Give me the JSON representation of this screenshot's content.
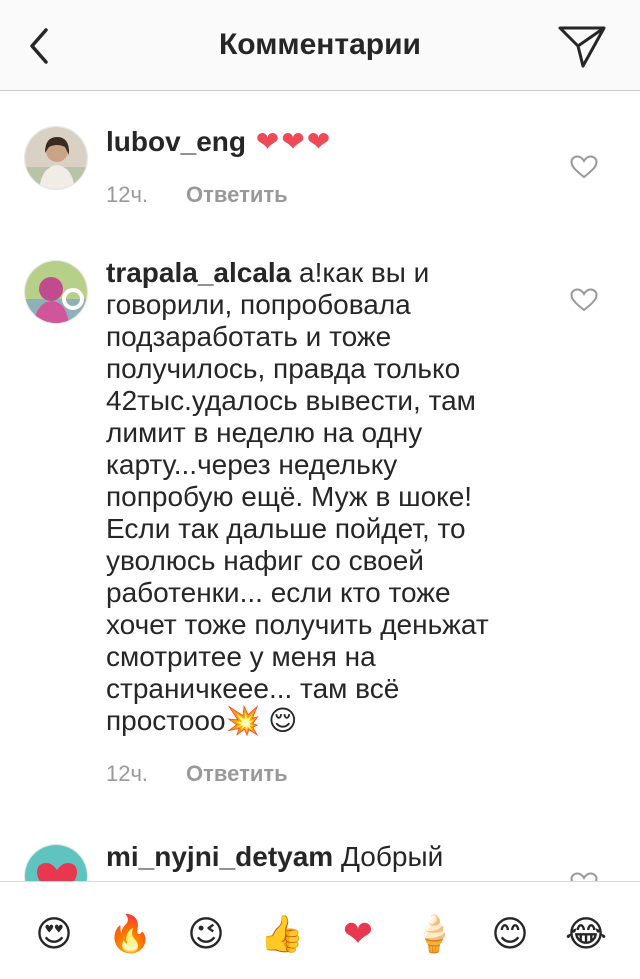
{
  "header": {
    "title": "Комментарии"
  },
  "comments": [
    {
      "username": "lubov_eng",
      "text": " ❤❤❤",
      "time": "12ч.",
      "reply_label": "Ответить"
    },
    {
      "username": "trapala_alcala",
      "text": " а!как вы и говорили, попробовала подзаработать и тоже получилось, правда только 42тыс.удалось вывести, там лимит в неделю на одну карту...через недельку попробую ещё. Муж в шоке! Если так дальше пойдет, то уволюсь нафиг со своей работенки... если кто тоже хочет тоже получить деньжат смотритее у меня на страничкеее... там всё простооо💥 😌",
      "time": "12ч.",
      "reply_label": "Ответить"
    },
    {
      "username": "mi_nyjni_detyam",
      "text": " Добрый"
    }
  ],
  "emoji_bar": [
    "😍",
    "🔥",
    "😉",
    "👍",
    "❤",
    "🍦",
    "😊",
    "😂"
  ],
  "colors": {
    "heart": "#ed4956",
    "muted": "#999999",
    "text": "#262626"
  }
}
